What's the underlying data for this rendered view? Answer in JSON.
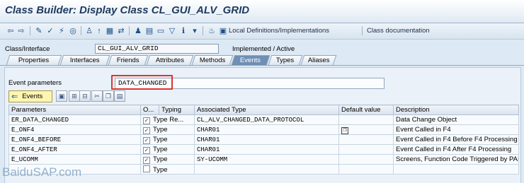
{
  "window": {
    "title": "Class Builder: Display Class CL_GUI_ALV_GRID"
  },
  "toolbar": {
    "local_definitions_label": "Local Definitions/Implementations",
    "class_documentation_label": "Class documentation"
  },
  "header": {
    "class_interface_label": "Class/Interface",
    "class_interface_value": "CL_GUI_ALV_GRID",
    "status": "Implemented / Active"
  },
  "tabs": [
    {
      "label": "Properties",
      "active": false
    },
    {
      "label": "Interfaces",
      "active": false
    },
    {
      "label": "Friends",
      "active": false
    },
    {
      "label": "Attributes",
      "active": false
    },
    {
      "label": "Methods",
      "active": false
    },
    {
      "label": "Events",
      "active": true
    },
    {
      "label": "Types",
      "active": false
    },
    {
      "label": "Aliases",
      "active": false
    }
  ],
  "event_parameters": {
    "label": "Event parameters",
    "value": "DATA_CHANGED",
    "events_button_label": "Events"
  },
  "table": {
    "columns": [
      "Parameters",
      "O...",
      "Typing",
      "Associated Type",
      "Default value",
      "Description"
    ],
    "rows": [
      {
        "parameter": "ER_DATA_CHANGED",
        "optional": true,
        "typing": "Type Re...",
        "associated_type": "CL_ALV_CHANGED_DATA_PROTOCOL",
        "default_value": "",
        "description": "Data Change Object"
      },
      {
        "parameter": "E_ONF4",
        "optional": true,
        "typing": "Type",
        "associated_type": "CHAR01",
        "default_value": "",
        "description": "Event Called in F4"
      },
      {
        "parameter": "E_ONF4_BEFORE",
        "optional": true,
        "typing": "Type",
        "associated_type": "CHAR01",
        "default_value": "",
        "description": "Event Called in F4 Before F4 Processing"
      },
      {
        "parameter": "E_ONF4_AFTER",
        "optional": true,
        "typing": "Type",
        "associated_type": "CHAR01",
        "default_value": "",
        "description": "Event Called in F4 After F4 Processing"
      },
      {
        "parameter": "E_UCOMM",
        "optional": true,
        "typing": "Type",
        "associated_type": "SY-UCOMM",
        "default_value": "",
        "description": "Screens, Function Code Triggered by PAI"
      },
      {
        "parameter": "",
        "optional": false,
        "typing": "Type",
        "associated_type": "",
        "default_value": "",
        "description": ""
      }
    ]
  },
  "watermark": "BaiduSAP.com",
  "colors": {
    "highlight_border": "#e0332f",
    "active_tab": "#6f8fb5",
    "title_text": "#1e3a5e"
  }
}
